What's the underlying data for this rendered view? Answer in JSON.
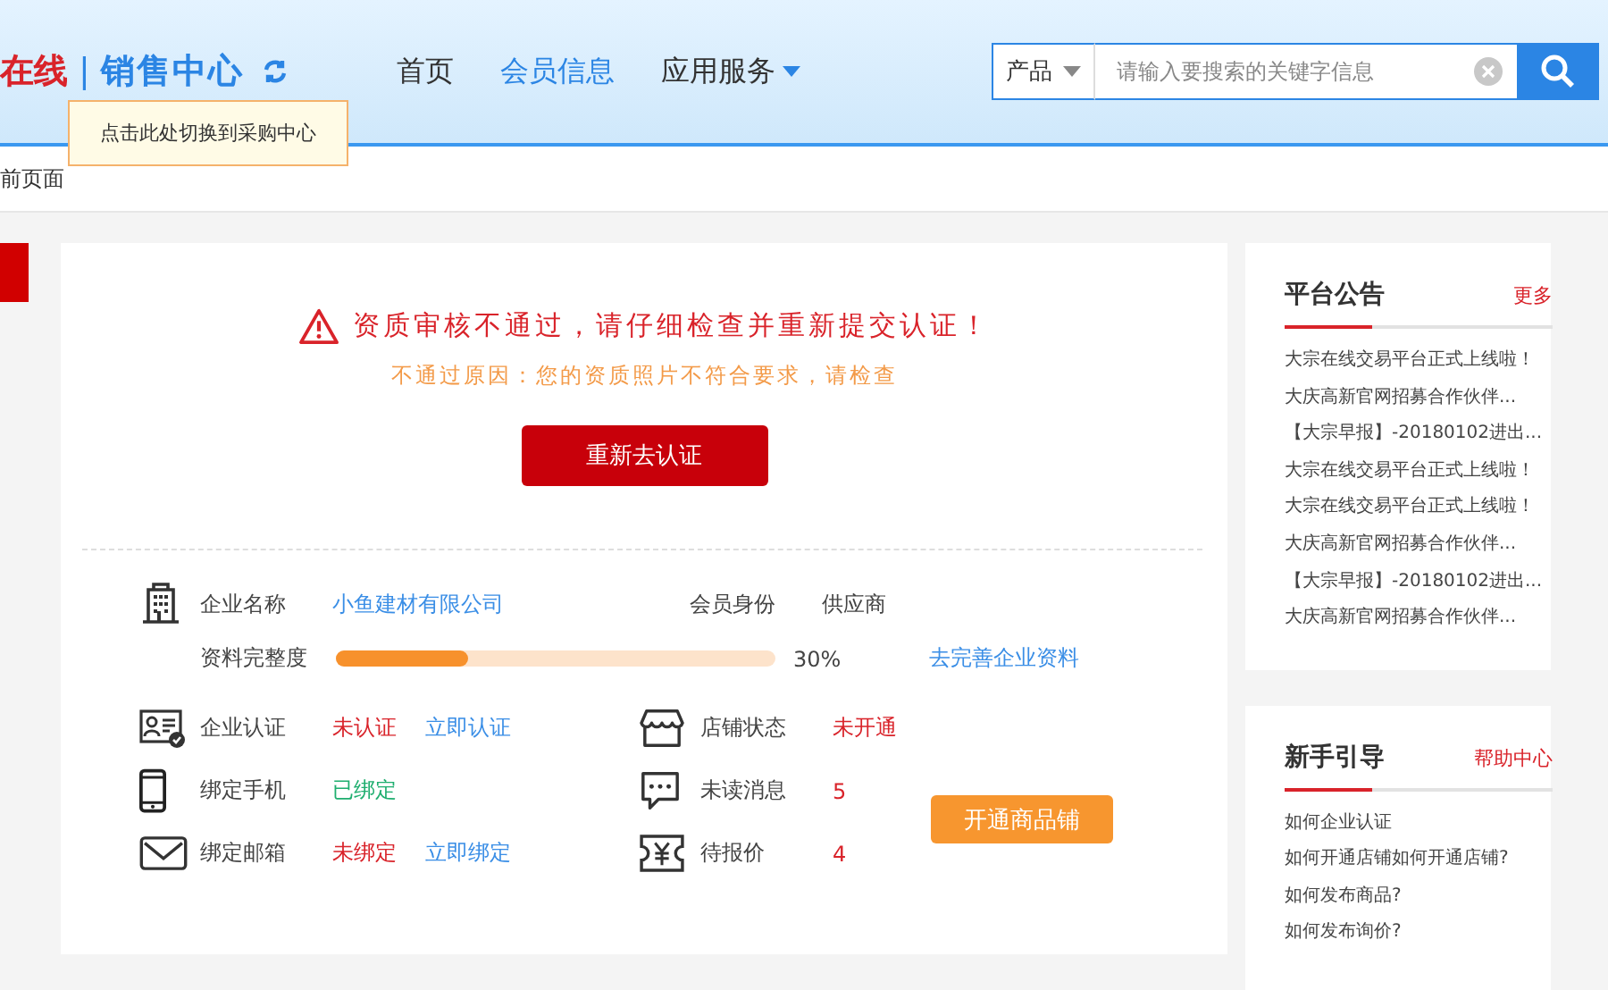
{
  "header": {
    "logo": {
      "brand": "在线",
      "separator": "|",
      "center": "销售中心"
    },
    "nav": [
      {
        "label": "首页",
        "selected": false,
        "has_menu": false
      },
      {
        "label": "会员信息",
        "selected": true,
        "has_menu": false
      },
      {
        "label": "应用服务",
        "selected": false,
        "has_menu": true
      }
    ],
    "search": {
      "category": "产品",
      "placeholder": "请输入要搜索的关键字信息"
    },
    "tooltip": "点击此处切换到采购中心"
  },
  "breadcrumb": "前页面",
  "alert": {
    "title": "资质审核不通过，请仔细检查并重新提交认证！",
    "reason": "不通过原因：您的资质照片不符合要求，请检查",
    "button": "重新去认证"
  },
  "profile": {
    "company_label": "企业名称",
    "company": "小鱼建材有限公司",
    "role_label": "会员身份",
    "role": "供应商",
    "completeness_label": "资料完整度",
    "level": 0.3,
    "percent": "30%",
    "complete_link": "去完善企业资料"
  },
  "account_status": [
    {
      "label": "企业认证",
      "value": "未认证",
      "color": "#d9232a",
      "action": "立即认证"
    },
    {
      "label": "绑定手机",
      "value": "已绑定",
      "color": "#1fae6f"
    },
    {
      "label": "绑定邮箱",
      "value": "未绑定",
      "color": "#d9232a",
      "action": "立即绑定"
    }
  ],
  "shop_status": [
    {
      "label": "店铺状态",
      "value": "未开通"
    },
    {
      "label": "未读消息",
      "value": "5"
    },
    {
      "label": "待报价",
      "value": "4"
    }
  ],
  "open_shop_button": "开通商品铺",
  "announcements": {
    "title": "平台公告",
    "more": "更多",
    "items": [
      "大宗在线交易平台正式上线啦！",
      "大庆高新官网招募合作伙伴...",
      "【大宗早报】-20180102进出...",
      "大宗在线交易平台正式上线啦！",
      "大宗在线交易平台正式上线啦！",
      "大庆高新官网招募合作伙伴...",
      "【大宗早报】-20180102进出...",
      "大庆高新官网招募合作伙伴..."
    ]
  },
  "guide": {
    "title": "新手引导",
    "more": "帮助中心",
    "items": [
      "如何企业认证",
      "如何开通店铺如何开通店铺?",
      "如何发布商品?",
      "如何发布询价?"
    ]
  }
}
